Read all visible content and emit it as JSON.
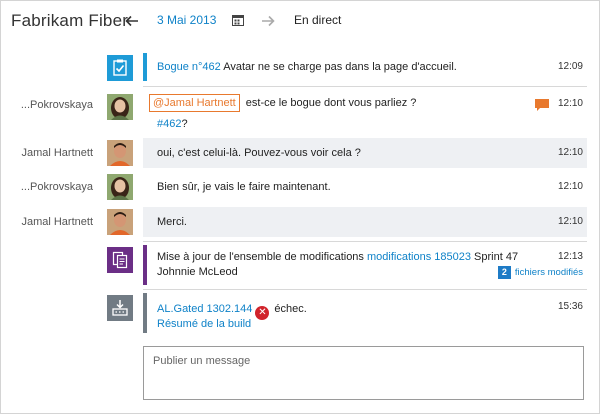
{
  "header": {
    "app_title": "Fabrikam Fiber",
    "date": "3 Mai 2013",
    "live_label": "En direct"
  },
  "colors": {
    "accent": "#0f82c8",
    "mention": "#e8792e",
    "work_item_bar": "#1e9bd7",
    "changeset_bar": "#6b2f86",
    "build_bar": "#717b84",
    "fail": "#d1232b"
  },
  "feed": {
    "items": [
      {
        "type": "work-item",
        "icon": "work-item-icon",
        "link": "Bogue n°462",
        "text": "Avatar ne se charge pas dans la page d'accueil.",
        "time": "12:09"
      },
      {
        "type": "message",
        "sender": "...Pokrovskaya",
        "mention": "@Jamal Hartnett",
        "text": "est-ce le bogue dont vous parliez ?",
        "second_link": "#462",
        "second_suffix": "?",
        "time": "12:10",
        "icon": "reply-bubble-icon"
      },
      {
        "type": "message",
        "sender": "Jamal Hartnett",
        "text": "oui, c'est celui-là. Pouvez-vous voir cela ?",
        "time": "12:10"
      },
      {
        "type": "message",
        "sender": "...Pokrovskaya",
        "text": "Bien sûr, je vais le faire maintenant.",
        "time": "12:10"
      },
      {
        "type": "message",
        "sender": "Jamal Hartnett",
        "text": "Merci.",
        "time": "12:10"
      },
      {
        "type": "changeset",
        "icon": "changeset-icon",
        "prefix": "Mise à jour de l'ensemble de modifications",
        "link": "modifications 185023",
        "suffix": "Sprint 47",
        "author": "Johnnie McLeod",
        "files_count": "2",
        "files_label": "fichiers modifiés",
        "time": "12:13"
      },
      {
        "type": "build",
        "icon": "build-icon",
        "link": "AL.Gated 1302.144",
        "status": "échec.",
        "summary_link": "Résumé de la build",
        "time": "15:36"
      }
    ]
  },
  "compose": {
    "placeholder": "Publier un message"
  }
}
